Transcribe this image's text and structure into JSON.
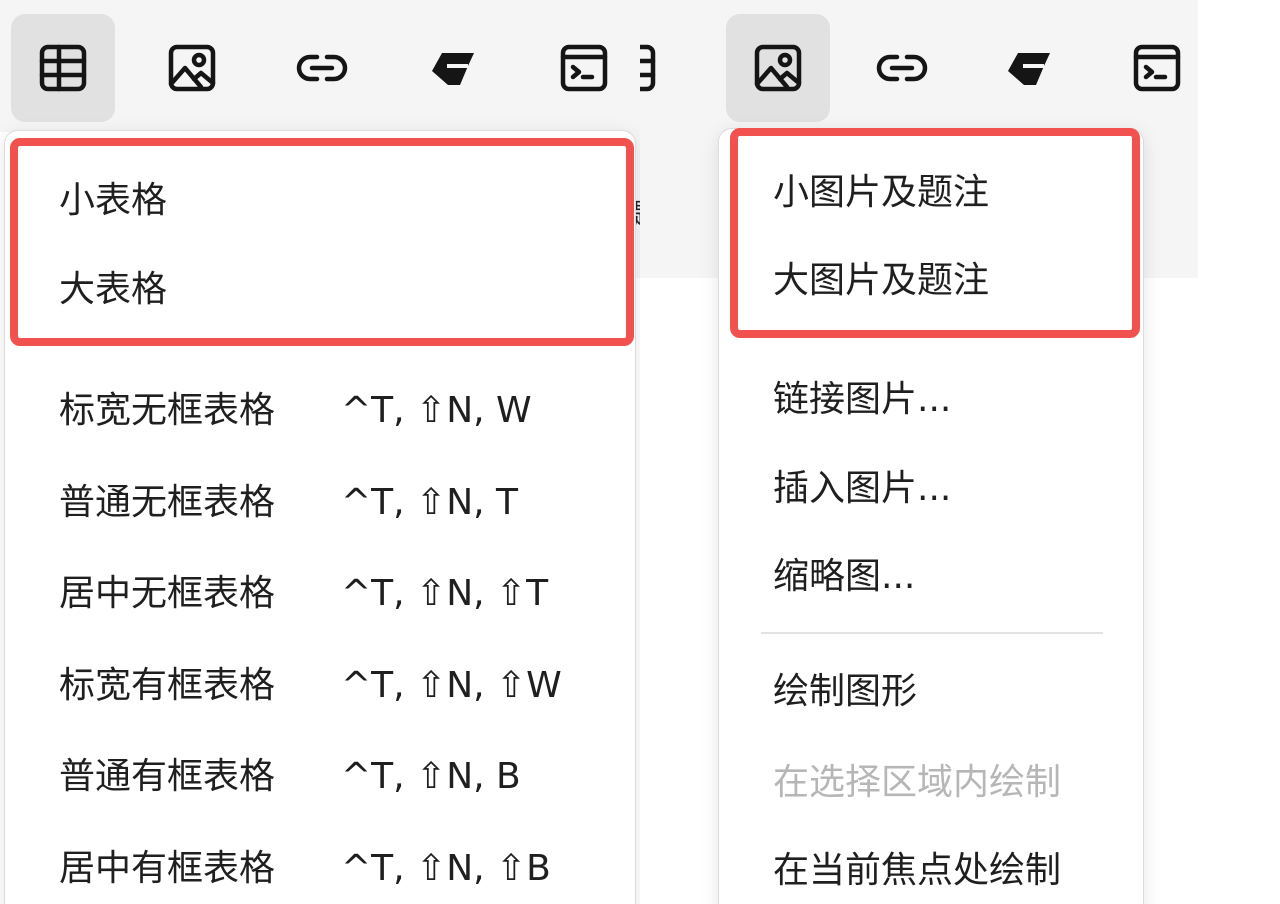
{
  "accent_color": "#f2524f",
  "left_panel": {
    "toolbar": {
      "buttons": [
        {
          "icon": "table-icon",
          "active": true
        },
        {
          "icon": "image-icon",
          "active": false
        },
        {
          "icon": "link-icon",
          "active": false
        },
        {
          "icon": "eraser-icon",
          "active": false
        },
        {
          "icon": "terminal-icon",
          "active": false
        }
      ]
    },
    "background_fragment": "题",
    "menu": {
      "highlighted": [
        {
          "label": "小表格"
        },
        {
          "label": "大表格"
        }
      ],
      "items": [
        {
          "label": "标宽无框表格",
          "shortcut": "^T, ⇧N, W"
        },
        {
          "label": "普通无框表格",
          "shortcut": "^T, ⇧N, T"
        },
        {
          "label": "居中无框表格",
          "shortcut": "^T, ⇧N, ⇧T"
        },
        {
          "label": "标宽有框表格",
          "shortcut": "^T, ⇧N, ⇧W"
        },
        {
          "label": "普通有框表格",
          "shortcut": "^T, ⇧N, B"
        },
        {
          "label": "居中有框表格",
          "shortcut": "^T, ⇧N, ⇧B"
        }
      ]
    }
  },
  "right_panel": {
    "toolbar": {
      "buttons": [
        {
          "icon": "table-icon",
          "active": false
        },
        {
          "icon": "image-icon",
          "active": true
        },
        {
          "icon": "link-icon",
          "active": false
        },
        {
          "icon": "eraser-icon",
          "active": false
        },
        {
          "icon": "terminal-icon",
          "active": false
        }
      ]
    },
    "menu": {
      "highlighted": [
        {
          "label": "小图片及题注"
        },
        {
          "label": "大图片及题注"
        }
      ],
      "items_group1": [
        {
          "label": "链接图片..."
        },
        {
          "label": "插入图片..."
        },
        {
          "label": "缩略图..."
        }
      ],
      "items_group2": [
        {
          "label": "绘制图形",
          "disabled": false
        },
        {
          "label": "在选择区域内绘制",
          "disabled": true
        },
        {
          "label": "在当前焦点处绘制",
          "disabled": false
        }
      ]
    }
  }
}
